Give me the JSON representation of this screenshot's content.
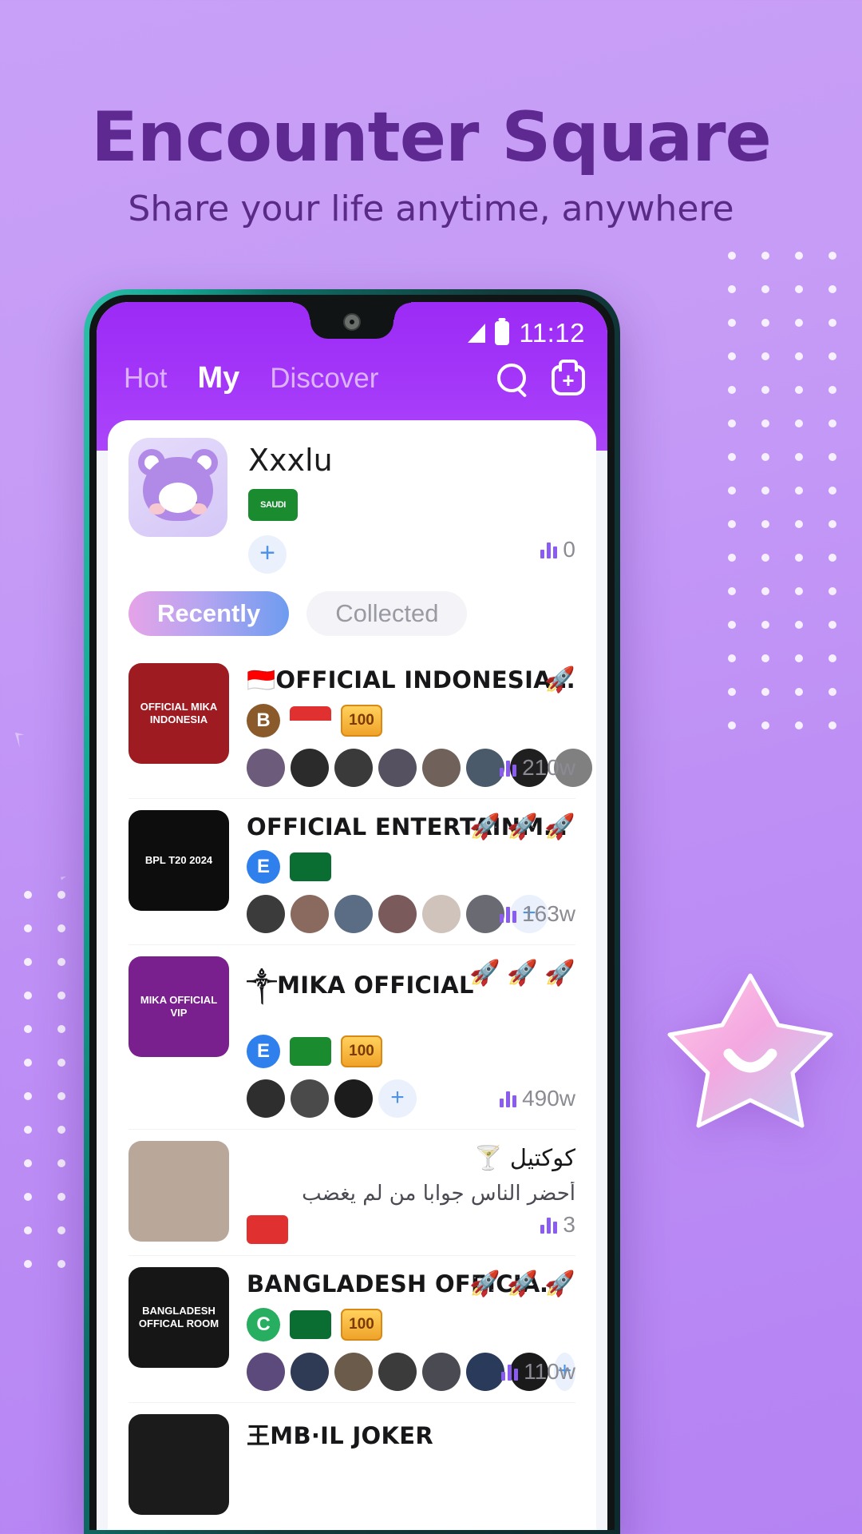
{
  "promo": {
    "headline": "Encounter Square",
    "subhead": "Share your life anytime, anywhere"
  },
  "colors": {
    "bg_top": "#c9a0f7",
    "bg_bottom": "#b583f3",
    "headline": "#5e2a91",
    "app_header": "#a234f8",
    "accent_bars": "#8a5cf0",
    "chip_gradient_start": "#e6a3e8",
    "chip_gradient_end": "#6e9cf0"
  },
  "status_bar": {
    "time": "11:12",
    "signal_icon": "signal-triangle-icon",
    "battery_icon": "battery-icon"
  },
  "header": {
    "tabs": [
      {
        "label": "Hot",
        "active": false
      },
      {
        "label": "My",
        "active": true
      },
      {
        "label": "Discover",
        "active": false
      }
    ],
    "search_icon": "search-icon",
    "add_room_icon": "add-room-icon"
  },
  "profile": {
    "name": "Xxxlu",
    "avatar_icon": "bear-avatar",
    "country_badge": "SAUDI",
    "add_label": "+",
    "count": "0",
    "count_icon": "bars-icon"
  },
  "filters": [
    {
      "label": "Recently",
      "active": true
    },
    {
      "label": "Collected",
      "active": false
    }
  ],
  "rooms": [
    {
      "thumb_text": "OFFICIAL MIKA INDONESIA",
      "thumb_bg": "#9e1b22",
      "title": "🇮🇩OFFICIAL INDONESIAN 🇮🇩",
      "rtl": false,
      "badges": [
        {
          "type": "circle",
          "text": "B",
          "color": "#8a5a2b"
        },
        {
          "type": "flag",
          "top": "#e03030",
          "bottom": "#ffffff"
        },
        {
          "type": "level",
          "text": "100"
        }
      ],
      "avatars": [
        "#6d5b7b",
        "#2b2b2b",
        "#3a3a3a",
        "#555160",
        "#70625a",
        "#4a5a6b",
        "#1f1f1f",
        "#808080"
      ],
      "show_plus": false,
      "rockets": [
        "🚀"
      ],
      "count": "210w"
    },
    {
      "thumb_text": "BPL T20 2024",
      "thumb_bg": "#0d0d0d",
      "title": "OFFICIAL ENTERTAINMENT ROO…",
      "rtl": false,
      "badges": [
        {
          "type": "circle",
          "text": "E",
          "color": "#2f80ed"
        },
        {
          "type": "flag",
          "top": "#0a6e33",
          "bottom": "#0a6e33"
        }
      ],
      "avatars": [
        "#3b3b3b",
        "#8a6a5e",
        "#5b6d84",
        "#7a5a5a",
        "#cfc3bb",
        "#6a6a72"
      ],
      "show_plus": true,
      "rockets": [
        "🚀",
        "🚀",
        "🚀"
      ],
      "count": "163w"
    },
    {
      "thumb_text": "MIKA OFFICIAL VIP",
      "thumb_bg": "#7a1f8e",
      "title": "༒MIKA OFFICIAL",
      "rtl": false,
      "badges": [
        {
          "type": "circle",
          "text": "E",
          "color": "#2f80ed"
        },
        {
          "type": "flag",
          "top": "#1b8b2f",
          "bottom": "#1b8b2f"
        },
        {
          "type": "level",
          "text": "100"
        }
      ],
      "avatars": [
        "#2e2e2e",
        "#4a4a4a",
        "#1c1c1c"
      ],
      "show_plus": true,
      "rockets": [
        "🚀",
        "🚀",
        "🚀"
      ],
      "count": "490w"
    },
    {
      "thumb_text": "",
      "thumb_bg": "#b9a79a",
      "title": "كوكتيل 🍸",
      "rtl": true,
      "badges": [
        {
          "type": "flag",
          "top": "#e03030",
          "bottom": "#e03030"
        }
      ],
      "subtitle": "أحضر الناس جوابا من لم يغضب",
      "avatars": [],
      "show_plus": false,
      "rockets": [],
      "count": "3"
    },
    {
      "thumb_text": "BANGLADESH OFFICAL ROOM",
      "thumb_bg": "#161616",
      "title": "BANGLADESH OFFICIAL ROOM🇧🇩",
      "rtl": false,
      "badges": [
        {
          "type": "circle",
          "text": "C",
          "color": "#27ae60"
        },
        {
          "type": "flag",
          "top": "#0a6e33",
          "bottom": "#0a6e33"
        },
        {
          "type": "level",
          "text": "100"
        }
      ],
      "avatars": [
        "#5b4a7b",
        "#2f3a55",
        "#6b5b4a",
        "#3b3b3b",
        "#4a4a52",
        "#2a3a5a",
        "#1a1a1a"
      ],
      "show_plus": true,
      "rockets": [
        "🚀",
        "🚀",
        "🚀"
      ],
      "count": "110w"
    },
    {
      "thumb_text": "",
      "thumb_bg": "#1b1b1b",
      "title": "王MB·IL JOKER",
      "rtl": false,
      "badges": [],
      "avatars": [],
      "show_plus": false,
      "rockets": [],
      "count": ""
    }
  ]
}
